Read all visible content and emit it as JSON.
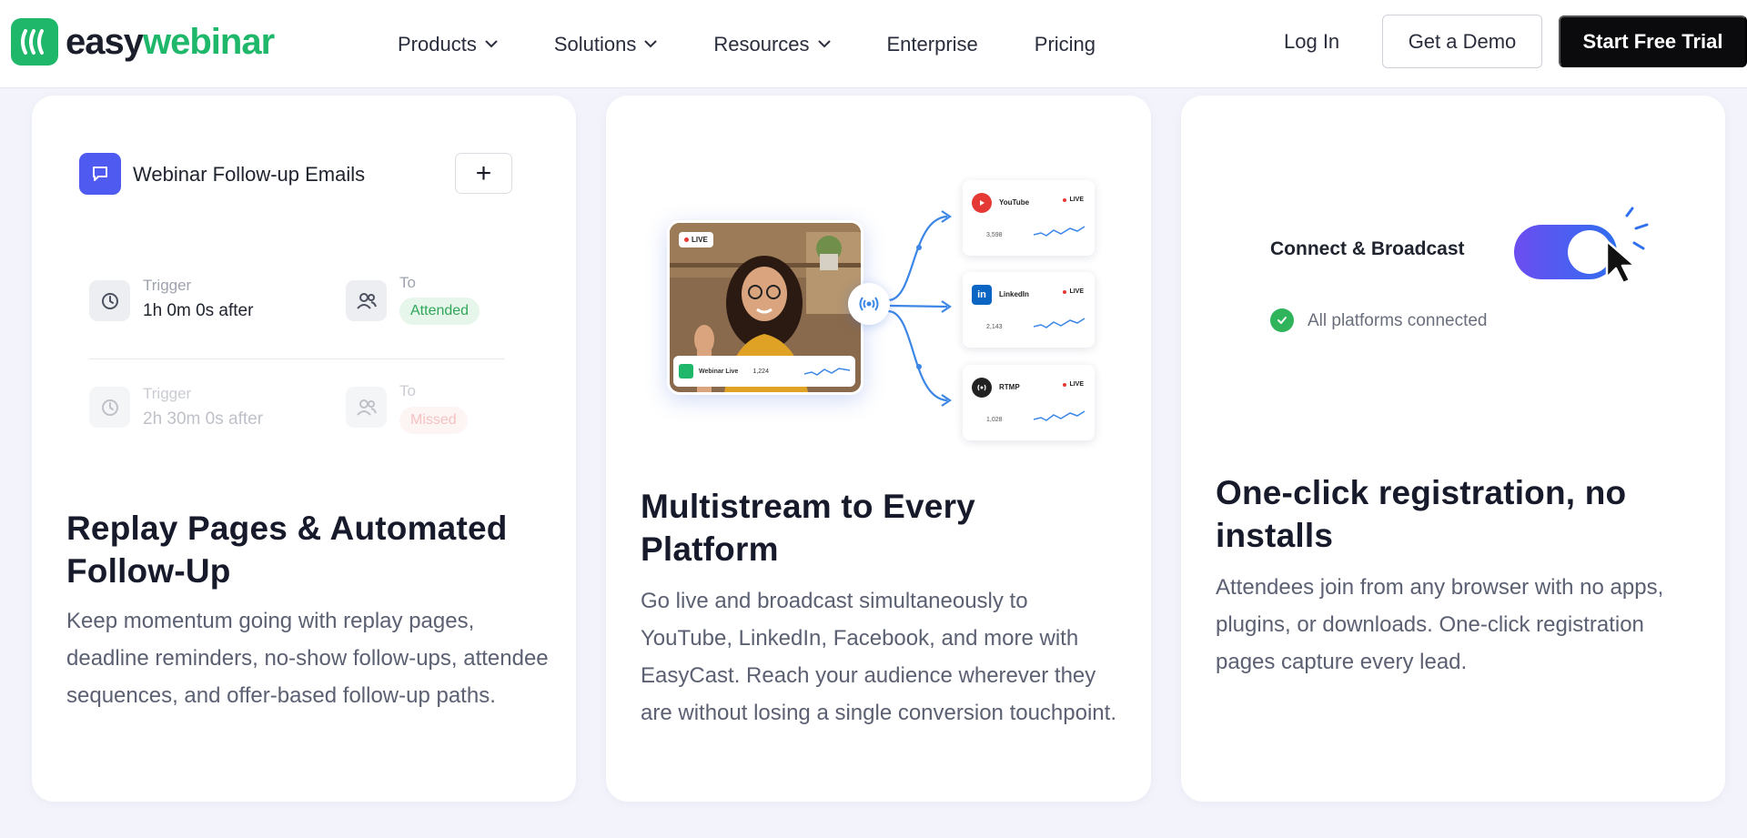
{
  "nav": {
    "logo": {
      "part1": "easy",
      "part2": "webinar"
    },
    "menu": [
      {
        "label": "Products",
        "dropdown": true
      },
      {
        "label": "Solutions",
        "dropdown": true
      },
      {
        "label": "Resources",
        "dropdown": true
      },
      {
        "label": "Enterprise",
        "dropdown": false
      },
      {
        "label": "Pricing",
        "dropdown": false
      }
    ],
    "login": "Log In",
    "demo": "Get a Demo",
    "trial": "Start Free Trial"
  },
  "cards": [
    {
      "title": "Replay Pages & Automated Follow-Up",
      "description": "Keep momentum going with replay pages, deadline reminders, no-show follow-ups, attendee sequences, and offer-based follow-up paths.",
      "illustration": {
        "header": "Webinar Follow-up Emails",
        "rows": [
          {
            "trigger_label": "Trigger",
            "trigger_value": "1h 0m 0s after",
            "to_label": "To",
            "status": "Attended"
          },
          {
            "trigger_label": "Trigger",
            "trigger_value": "2h 30m 0s after",
            "to_label": "To",
            "status": "Missed"
          }
        ]
      }
    },
    {
      "title": "Multistream to Every Platform",
      "description": "Go live and broadcast simultaneously to YouTube, LinkedIn, Facebook, and more with EasyCast. Reach your audience wherever they are without losing a single conversion touchpoint.",
      "illustration": {
        "live_tag": "LIVE",
        "source_label": "Webinar Live",
        "source_count": "1,224",
        "platforms": [
          {
            "name": "YouTube",
            "live": "LIVE",
            "count": "3,598"
          },
          {
            "name": "LinkedIn",
            "live": "LIVE",
            "count": "2,143"
          },
          {
            "name": "RTMP",
            "live": "LIVE",
            "count": "1,028"
          }
        ]
      }
    },
    {
      "title": "One-click registration, no installs",
      "description": "Attendees join from any browser with no apps, plugins, or downloads. One-click registration pages capture every lead.",
      "illustration": {
        "label": "Connect & Broadcast",
        "status": "All platforms connected"
      }
    }
  ],
  "colors": {
    "brand_green": "#1fb86a",
    "accent_blue": "#4f5af0",
    "toggle_start": "#6c4df0",
    "toggle_end": "#2f6ff0",
    "success": "#2fb45c"
  }
}
